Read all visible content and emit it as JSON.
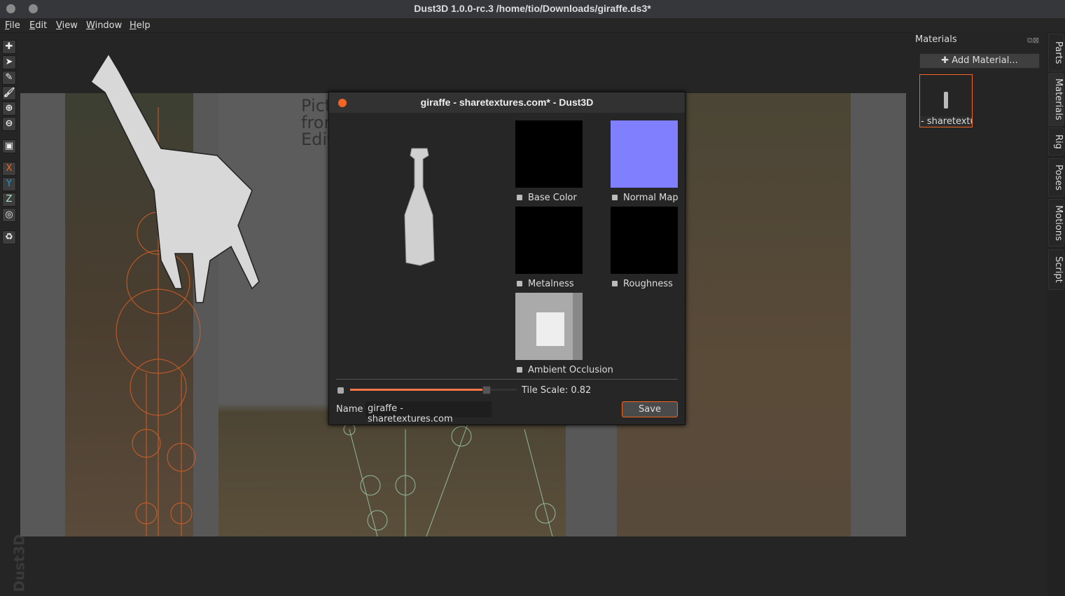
{
  "window": {
    "title": "Dust3D 1.0.0-rc.3 /home/tio/Downloads/giraffe.ds3*"
  },
  "menu": [
    "File",
    "Edit",
    "View",
    "Window",
    "Help"
  ],
  "toolbar": {
    "icons": [
      "add-icon",
      "select-icon",
      "edit-icon",
      "paint-icon",
      "zoom-in-icon",
      "zoom-out-icon",
      "reference-image-icon"
    ],
    "axes": [
      "X",
      "Y",
      "Z"
    ],
    "axis_colors": [
      "#f26522",
      "#1e9bd7",
      "#aee8c5"
    ]
  },
  "watermark": "Dust3D",
  "background_text": [
    "Pict",
    "fron",
    "Edit"
  ],
  "dialog": {
    "title": "giraffe - sharetextures.com* - Dust3D",
    "textures": [
      {
        "label": "Base Color",
        "color": "#000000"
      },
      {
        "label": "Normal Map",
        "color": "#8080ff"
      },
      {
        "label": "Metalness",
        "color": "#000000"
      },
      {
        "label": "Roughness",
        "color": "#000000"
      },
      {
        "label": "Ambient Occlusion",
        "color": "#cccccc"
      }
    ],
    "tile_scale_label": "Tile Scale: 0.82",
    "tile_scale_fraction": 0.82,
    "name_label": "Name",
    "name_value": "giraffe - sharetextures.com",
    "save": "Save"
  },
  "materials_panel": {
    "title": "Materials",
    "add": "Add Material...",
    "items": [
      {
        "label": "- sharetextur"
      }
    ]
  },
  "side_tabs": [
    "Parts",
    "Materials",
    "Rig",
    "Poses",
    "Motions",
    "Script"
  ],
  "accent": "#f26522"
}
